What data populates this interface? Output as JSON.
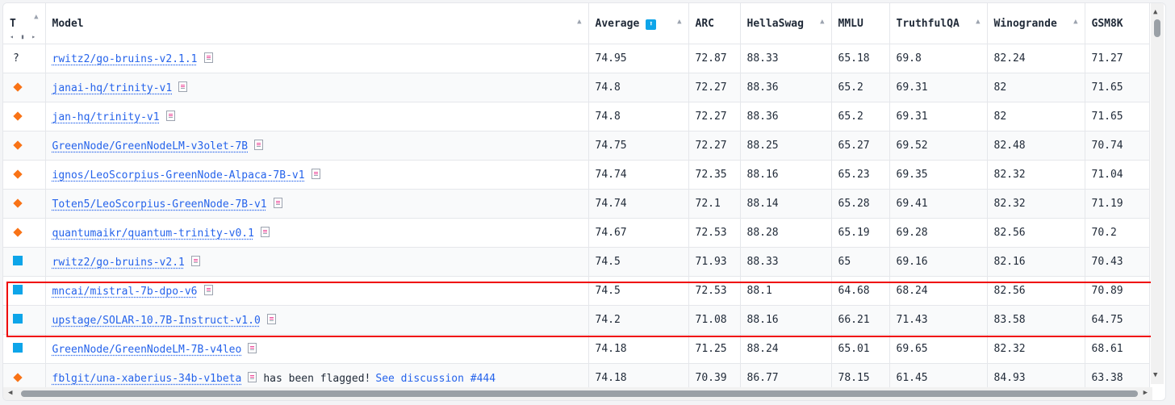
{
  "columns": {
    "type": "T",
    "model": "Model",
    "average": "Average",
    "arc": "ARC",
    "hellaswag": "HellaSwag",
    "mmlu": "MMLU",
    "truthfulqa": "TruthfulQA",
    "winogrande": "Winogrande",
    "gsm8k": "GSM8K"
  },
  "type_sub_icons": "◂ ▮ ▸",
  "sort_indicator": "⬆",
  "accent_color": "#0ea5e9",
  "type_colors": {
    "diamond": "#f97316",
    "square": "#0ea5e9"
  },
  "rows": [
    {
      "type": "?",
      "model": "rwitz2/go-bruins-v2.1.1",
      "average": "74.95",
      "arc": "72.87",
      "hellaswag": "88.33",
      "mmlu": "65.18",
      "truthfulqa": "69.8",
      "winogrande": "82.24",
      "gsm8k": "71.27"
    },
    {
      "type": "diamond",
      "model": "janai-hq/trinity-v1",
      "average": "74.8",
      "arc": "72.27",
      "hellaswag": "88.36",
      "mmlu": "65.2",
      "truthfulqa": "69.31",
      "winogrande": "82",
      "gsm8k": "71.65"
    },
    {
      "type": "diamond",
      "model": "jan-hq/trinity-v1",
      "average": "74.8",
      "arc": "72.27",
      "hellaswag": "88.36",
      "mmlu": "65.2",
      "truthfulqa": "69.31",
      "winogrande": "82",
      "gsm8k": "71.65"
    },
    {
      "type": "diamond",
      "model": "GreenNode/GreenNodeLM-v3olet-7B",
      "average": "74.75",
      "arc": "72.27",
      "hellaswag": "88.25",
      "mmlu": "65.27",
      "truthfulqa": "69.52",
      "winogrande": "82.48",
      "gsm8k": "70.74"
    },
    {
      "type": "diamond",
      "model": "ignos/LeoScorpius-GreenNode-Alpaca-7B-v1",
      "average": "74.74",
      "arc": "72.35",
      "hellaswag": "88.16",
      "mmlu": "65.23",
      "truthfulqa": "69.35",
      "winogrande": "82.32",
      "gsm8k": "71.04"
    },
    {
      "type": "diamond",
      "model": "Toten5/LeoScorpius-GreenNode-7B-v1",
      "average": "74.74",
      "arc": "72.1",
      "hellaswag": "88.14",
      "mmlu": "65.28",
      "truthfulqa": "69.41",
      "winogrande": "82.32",
      "gsm8k": "71.19"
    },
    {
      "type": "diamond",
      "model": "quantumaikr/quantum-trinity-v0.1",
      "average": "74.67",
      "arc": "72.53",
      "hellaswag": "88.28",
      "mmlu": "65.19",
      "truthfulqa": "69.28",
      "winogrande": "82.56",
      "gsm8k": "70.2"
    },
    {
      "type": "square",
      "model": "rwitz2/go-bruins-v2.1",
      "average": "74.5",
      "arc": "71.93",
      "hellaswag": "88.33",
      "mmlu": "65",
      "truthfulqa": "69.16",
      "winogrande": "82.16",
      "gsm8k": "70.43"
    },
    {
      "type": "square",
      "model": "mncai/mistral-7b-dpo-v6",
      "average": "74.5",
      "arc": "72.53",
      "hellaswag": "88.1",
      "mmlu": "64.68",
      "truthfulqa": "68.24",
      "winogrande": "82.56",
      "gsm8k": "70.89"
    },
    {
      "type": "square",
      "model": "upstage/SOLAR-10.7B-Instruct-v1.0",
      "average": "74.2",
      "arc": "71.08",
      "hellaswag": "88.16",
      "mmlu": "66.21",
      "truthfulqa": "71.43",
      "winogrande": "83.58",
      "gsm8k": "64.75"
    },
    {
      "type": "square",
      "model": "GreenNode/GreenNodeLM-7B-v4leo",
      "average": "74.18",
      "arc": "71.25",
      "hellaswag": "88.24",
      "mmlu": "65.01",
      "truthfulqa": "69.65",
      "winogrande": "82.32",
      "gsm8k": "68.61"
    },
    {
      "type": "diamond",
      "model": "fblgit/una-xaberius-34b-v1beta",
      "flag_text": "has been flagged!",
      "flag_link": "See discussion #444",
      "average": "74.18",
      "arc": "70.39",
      "hellaswag": "86.77",
      "mmlu": "78.15",
      "truthfulqa": "61.45",
      "winogrande": "84.93",
      "gsm8k": "63.38"
    }
  ],
  "highlight_color": "#ef0000"
}
